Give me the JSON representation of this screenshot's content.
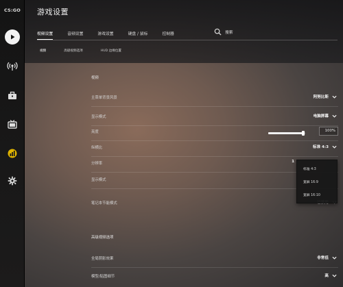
{
  "app": {
    "logo_text": "CS:GO"
  },
  "sidebar": {
    "icons": [
      "play-icon",
      "broadcast-icon",
      "inventory-icon",
      "tv-icon",
      "stats-icon",
      "settings-gear-icon"
    ]
  },
  "header": {
    "title": "游戏设置",
    "tabs": [
      {
        "label": "视频设置",
        "active": true
      },
      {
        "label": "音频设置",
        "active": false
      },
      {
        "label": "游戏设置",
        "active": false
      },
      {
        "label": "键盘 / 鼠标",
        "active": false
      },
      {
        "label": "控制器",
        "active": false
      }
    ],
    "search_label": "搜索",
    "subtabs": [
      {
        "label": "视频",
        "active": true
      },
      {
        "label": "高级视频选项",
        "active": false
      },
      {
        "label": "HUD 边缘位置",
        "active": false
      }
    ]
  },
  "video": {
    "section_title": "视频",
    "rows": {
      "menu_bg": {
        "label": "主菜单背景风景",
        "value": "阿努比斯"
      },
      "display_mode": {
        "label": "显示模式",
        "value": "电脑屏幕"
      },
      "brightness": {
        "label": "亮度",
        "value": "100%",
        "level": 0.95
      },
      "aspect_ratio": {
        "label": "纵横比",
        "value": "标准 4:3"
      },
      "resolution": {
        "label": "分辨率",
        "value": "1"
      },
      "display_mode2": {
        "label": "显示模式",
        "value": ""
      },
      "laptop_power": {
        "label": "笔记本节能模式",
        "value": "已禁用"
      }
    },
    "aspect_dropdown_options": [
      "标准 4:3",
      "宽屏 16:9",
      "宽屏 16:10"
    ]
  },
  "advanced": {
    "section_title": "高级视频选项",
    "rows": {
      "shadow": {
        "label": "全局阴影效果",
        "value": "非常低"
      },
      "model_detail": {
        "label": "模型/贴图细节",
        "value": "高"
      }
    }
  },
  "colors": {
    "accent": "#ffffff",
    "sidebar_bg": "#161616",
    "dropdown_bg": "#181818"
  }
}
